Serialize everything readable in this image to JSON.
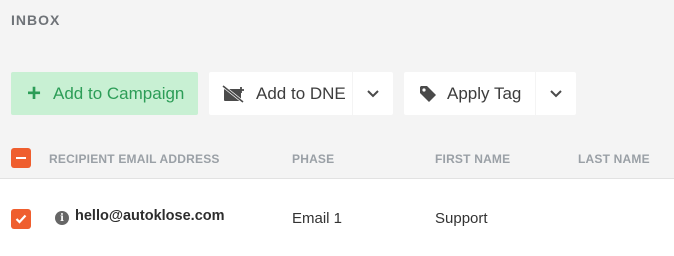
{
  "header": {
    "title": "INBOX"
  },
  "toolbar": {
    "add_campaign_label": "Add to Campaign",
    "add_dne_label": "Add to DNE",
    "apply_tag_label": "Apply Tag"
  },
  "table": {
    "columns": [
      "RECIPIENT EMAIL ADDRESS",
      "PHASE",
      "FIRST NAME",
      "LAST NAME"
    ],
    "rows": [
      {
        "email": "hello@autoklose.com",
        "phase": "Email 1",
        "first_name": "Support",
        "last_name": "",
        "checked": true
      }
    ]
  },
  "colors": {
    "accent": "#ef5e2e",
    "campaign_bg": "#c8f0d3",
    "campaign_text": "#2c9d57"
  }
}
